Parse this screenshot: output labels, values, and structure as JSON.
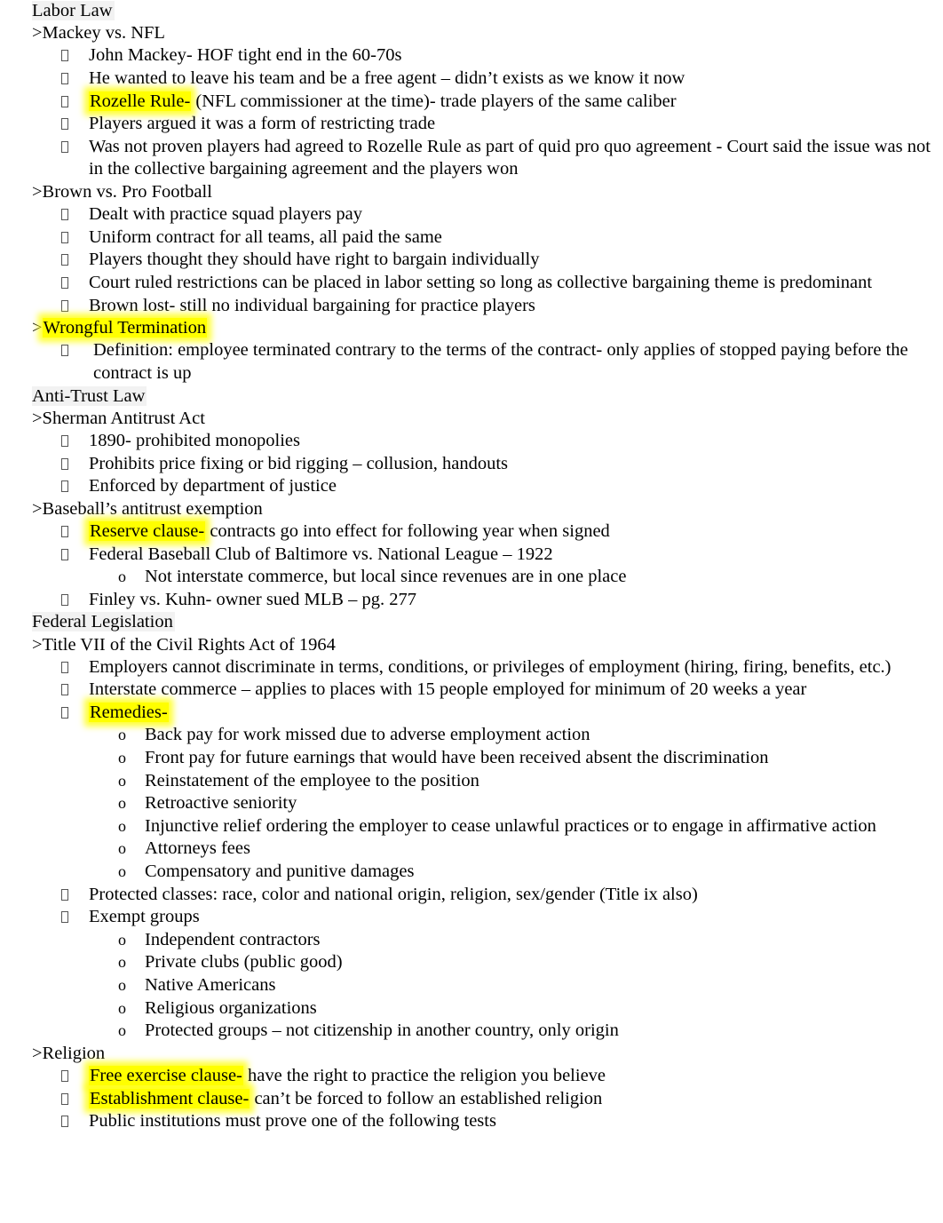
{
  "document": {
    "title": "Labor Law",
    "page_background": "#ffffff",
    "highlight_color": "#ffff00",
    "heading_shade_color": "#f2f2f2",
    "text_color": "#000000"
  },
  "sections": [
    {
      "heading": "Labor Law",
      "topics": [
        {
          "label": ">Mackey vs. NFL",
          "bullets": [
            {
              "text": "John Mackey- HOF tight end in the 60-70s"
            },
            {
              "text": "He wanted to leave his team and be a free agent – didn’t exists as we know it now"
            },
            {
              "highlight": "Rozelle Rule-",
              "text": " (NFL commissioner at the time)- trade players of the same caliber"
            },
            {
              "text": "Players argued it was a form of restricting trade"
            },
            {
              "text": "Was not proven players had agreed to Rozelle Rule as part of quid pro quo agreement - Court said the issue was not in the collective bargaining agreement and the players won"
            }
          ]
        },
        {
          "label": ">Brown vs. Pro Football",
          "bullets": [
            {
              "text": "Dealt with practice squad players pay"
            },
            {
              "text": "Uniform contract for all teams, all paid the same"
            },
            {
              "text": "Players thought they should have right to bargain individually"
            },
            {
              "text": "Court ruled restrictions can be placed in labor setting so long as collective bargaining theme is predominant"
            },
            {
              "text": "Brown lost- still no individual bargaining for practice players"
            }
          ]
        },
        {
          "label": ">Wrongful Termination",
          "label_highlight": "Wrongful Termination",
          "bullets": [
            {
              "text": " Definition: employee terminated contrary to the terms of the contract- only applies of stopped paying before the contract is up"
            }
          ]
        }
      ]
    },
    {
      "heading": "Anti-Trust Law",
      "topics": [
        {
          "label": ">Sherman Antitrust Act",
          "bullets": [
            {
              "text": "1890- prohibited monopolies"
            },
            {
              "text": "Prohibits price fixing or bid rigging – collusion, handouts"
            },
            {
              "text": "Enforced by department of justice"
            }
          ]
        },
        {
          "label": ">Baseball’s antitrust exemption",
          "bullets": [
            {
              "highlight": "Reserve clause-",
              "text": " contracts go into effect for following year when signed"
            },
            {
              "text": "Federal Baseball Club of Baltimore vs. National League – 1922",
              "subs": [
                "Not interstate commerce, but local since revenues are in one place"
              ]
            },
            {
              "text": "Finley vs. Kuhn- owner sued MLB – pg. 277"
            }
          ]
        }
      ]
    },
    {
      "heading": "Federal Legislation",
      "topics": [
        {
          "label": ">Title VII of the Civil Rights Act of 1964",
          "bullets": [
            {
              "text": "Employers cannot discriminate in terms, conditions, or privileges of employment (hiring, firing, benefits, etc.)"
            },
            {
              "text": "Interstate commerce – applies to places with 15 people employed for minimum of 20 weeks a year"
            },
            {
              "highlight": "Remedies-",
              "text": "",
              "subs": [
                "Back pay for work missed due to adverse employment action",
                "Front pay for future earnings that would have been received absent the discrimination",
                "Reinstatement of the employee to the position",
                "Retroactive seniority",
                "Injunctive relief ordering the employer to cease unlawful practices or to engage in affirmative action",
                "Attorneys fees",
                "Compensatory and punitive damages"
              ]
            },
            {
              "text": "Protected classes: race, color and national origin, religion, sex/gender (Title ix also)"
            },
            {
              "text": "Exempt groups",
              "subs": [
                "Independent contractors",
                "Private clubs (public good)",
                "Native Americans",
                "Religious organizations",
                "Protected groups – not citizenship in another country, only origin"
              ]
            }
          ]
        },
        {
          "label": ">Religion",
          "bullets": [
            {
              "highlight": "Free exercise clause-",
              "text": " have the right to practice the religion you believe"
            },
            {
              "highlight": "Establishment clause-",
              "text": " can’t be forced to follow an established religion"
            },
            {
              "text": "Public institutions must prove one of the following tests"
            }
          ]
        }
      ]
    }
  ]
}
